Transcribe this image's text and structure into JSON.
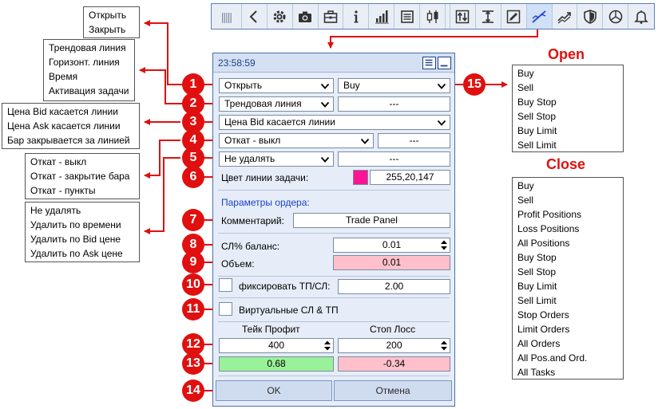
{
  "panel": {
    "time": "23:58:59",
    "action_select": "Открыть",
    "order_type_select": "Buy",
    "line_select": "Трендовая линия",
    "line_value": "---",
    "trigger_select": "Цена Bid касается линии",
    "rollback_select": "Откат - выкл",
    "rollback_value": "---",
    "delete_select": "Не удалять",
    "delete_value": "---",
    "line_color_label": "Цвет линии задачи:",
    "line_color_value": "255,20,147",
    "line_color_hex": "#ff1493",
    "order_params_label": "Параметры ордера:",
    "comment_label": "Комментарий:",
    "comment_value": "Trade Panel",
    "sl_balance_label": "СЛ% баланс:",
    "sl_balance_value": "0.01",
    "volume_label": "Объем:",
    "volume_value": "0.01",
    "fix_tpsl_label": "фиксировать ТП/СЛ:",
    "fix_tpsl_value": "2.00",
    "virtual_label": "Виртуальные СЛ & ТП",
    "tp_label": "Тейк Профит",
    "sl_label": "Стоп Лосс",
    "tp_value": "400",
    "sl_value": "200",
    "tp_result": "0.68",
    "sl_result": "-0.34",
    "ok_label": "OK",
    "cancel_label": "Отмена"
  },
  "toolbar": {
    "icons": [
      "grip-icon",
      "back-arrow-icon",
      "gear-icon",
      "camera-icon",
      "briefcase-icon",
      "info-icon",
      "signal-bars-icon",
      "list-icon",
      "candlestick-icon",
      "sort-arrows-icon",
      "vertical-range-icon",
      "edit-note-icon",
      "trend-line-icon",
      "trend-chart-icon",
      "shield-icon",
      "pie-chart-icon",
      "bell-icon"
    ]
  },
  "badges": [
    "1",
    "2",
    "3",
    "4",
    "5",
    "6",
    "7",
    "8",
    "9",
    "10",
    "11",
    "12",
    "13",
    "14",
    "15"
  ],
  "lists": {
    "action": [
      "Открыть",
      "Закрыть"
    ],
    "line": [
      "Трендовая линия",
      "Горизонт. линия",
      "Время",
      "Активация задачи"
    ],
    "trigger": [
      "Цена Bid касается линии",
      "Цена Ask касается линии",
      "Бар закрывается за линией"
    ],
    "rollback": [
      "Откат - выкл",
      "Откат - закрытие бара",
      "Откат - пункты"
    ],
    "delete": [
      "Не удалять",
      "Удалить по времени",
      "Удалить по Bid цене",
      "Удалить по Ask цене"
    ],
    "open_title": "Open",
    "open": [
      "Buy",
      "Sell",
      "Buy Stop",
      "Sell Stop",
      "Buy Limit",
      "Sell Limit"
    ],
    "close_title": "Close",
    "close": [
      "Buy",
      "Sell",
      "Profit Positions",
      "Loss Positions",
      "All Positions",
      "Buy Stop",
      "Sell Stop",
      "Buy Limit",
      "Sell Limit",
      "Stop Orders",
      "Limit Orders",
      "All Orders",
      "All Pos.and Ord.",
      "All Tasks"
    ]
  },
  "colors": {
    "badge": "#e01010",
    "title": "#e01010",
    "volume_bg": "#ffc0cb",
    "tp_result_bg": "#99f199",
    "sl_result_bg": "#ffc0cb",
    "clock": "#1a3f8b",
    "order_params": "#1a3fcc"
  }
}
